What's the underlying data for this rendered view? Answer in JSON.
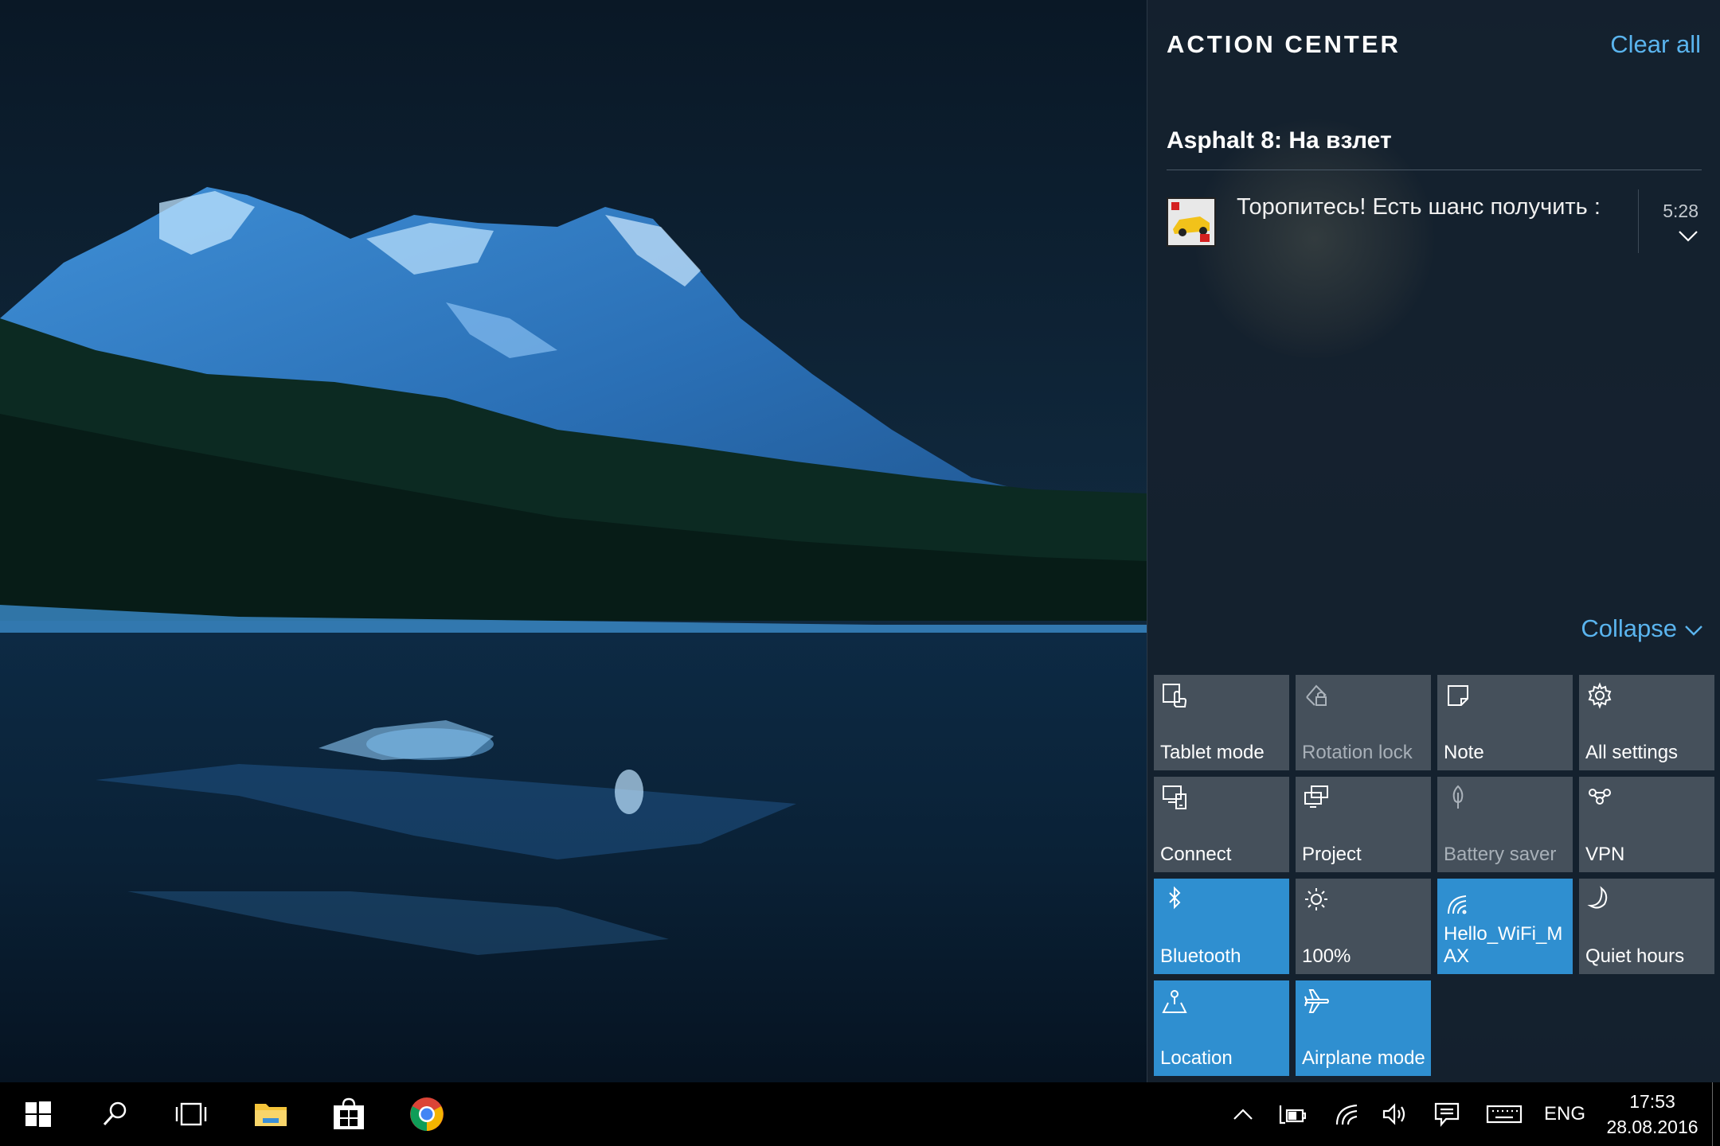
{
  "action_center": {
    "title": "ACTION CENTER",
    "clear_all": "Clear all",
    "notification_group": {
      "app_name": "Asphalt 8: На взлет",
      "notifications": [
        {
          "text": "Торопитесь! Есть шанс получить :",
          "time": "5:28",
          "app_icon": "asphalt-app-icon"
        }
      ]
    },
    "collapse_label": "Collapse",
    "quick_actions": [
      {
        "label": "Tablet mode",
        "icon": "tablet-mode-icon",
        "state": "off"
      },
      {
        "label": "Rotation lock",
        "icon": "rotation-lock-icon",
        "state": "disabled"
      },
      {
        "label": "Note",
        "icon": "note-icon",
        "state": "off"
      },
      {
        "label": "All settings",
        "icon": "gear-icon",
        "state": "off"
      },
      {
        "label": "Connect",
        "icon": "connect-icon",
        "state": "off"
      },
      {
        "label": "Project",
        "icon": "project-icon",
        "state": "off"
      },
      {
        "label": "Battery saver",
        "icon": "battery-saver-icon",
        "state": "disabled"
      },
      {
        "label": "VPN",
        "icon": "vpn-icon",
        "state": "off"
      },
      {
        "label": "Bluetooth",
        "icon": "bluetooth-icon",
        "state": "on"
      },
      {
        "label": "100%",
        "icon": "brightness-icon",
        "state": "off"
      },
      {
        "label": "Hello_WiFi_MAX",
        "icon": "wifi-icon",
        "state": "on"
      },
      {
        "label": "Quiet hours",
        "icon": "moon-icon",
        "state": "off"
      },
      {
        "label": "Location",
        "icon": "location-icon",
        "state": "on"
      },
      {
        "label": "Airplane mode",
        "icon": "airplane-icon",
        "state": "on"
      }
    ]
  },
  "taskbar": {
    "pinned": [
      {
        "name": "start-button",
        "icon": "windows-logo-icon"
      },
      {
        "name": "search-button",
        "icon": "search-icon"
      },
      {
        "name": "task-view-button",
        "icon": "task-view-icon"
      },
      {
        "name": "file-explorer-button",
        "icon": "folder-icon"
      },
      {
        "name": "store-button",
        "icon": "store-icon"
      },
      {
        "name": "chrome-button",
        "icon": "chrome-icon"
      }
    ],
    "tray": {
      "language": "ENG",
      "time": "17:53",
      "date": "28.08.2016",
      "icons": [
        "chevron-up-icon",
        "power-icon",
        "wifi-icon",
        "volume-icon",
        "action-center-icon",
        "keyboard-icon"
      ]
    }
  },
  "colors": {
    "accent": "#2f8fd0",
    "link": "#5ab4ee",
    "tile_off": "#6e7882"
  }
}
